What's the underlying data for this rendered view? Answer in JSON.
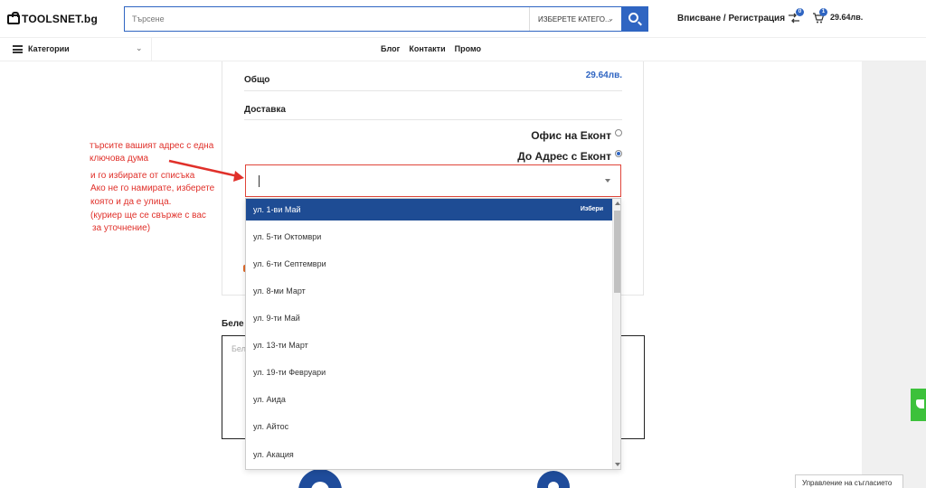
{
  "header": {
    "logo_text": "TOOLSNET.bg",
    "search_placeholder": "Търсене",
    "category_select": "ИЗБЕРЕТЕ КАТЕГО...",
    "login_text": "Вписване / Регистрация",
    "compare_count": "0",
    "cart_count": "1",
    "cart_total": "29.64лв."
  },
  "nav": {
    "categories_label": "Категории",
    "links": [
      "Блог",
      "Контакти",
      "Промо"
    ]
  },
  "order": {
    "total_label": "Общо",
    "total_value": "29.64лв.",
    "delivery_label": "Доставка",
    "options": [
      {
        "label": "Офис на Еконт",
        "selected": false
      },
      {
        "label": "До Адрес с Еконт",
        "selected": true
      }
    ]
  },
  "address_select": {
    "value": "",
    "options": [
      {
        "label": "ул. 1-ви Май",
        "hint": "Избери",
        "highlighted": true
      },
      {
        "label": "ул. 5-ти Октомври"
      },
      {
        "label": "ул. 6-ти Септември"
      },
      {
        "label": "ул. 8-ми Март"
      },
      {
        "label": "ул. 9-ти Май"
      },
      {
        "label": "ул. 13-ти Март"
      },
      {
        "label": "ул. 19-ти Февруари"
      },
      {
        "label": "ул. Аида"
      },
      {
        "label": "ул. Айтос"
      },
      {
        "label": "ул. Акация"
      }
    ]
  },
  "notes": {
    "label": "Беле",
    "placeholder": "Беле"
  },
  "annotation": {
    "line1": "търсите вашият адрес с една",
    "line2": "ключова дума",
    "line3": "и го избирате от списъка",
    "line4": "Ако не го намирате, изберете",
    "line5": "която и да е улица.",
    "line6": "(куриер ще се свърже с вас",
    "line7": "за уточнение)"
  },
  "consent_label": "Управление на съгласието",
  "colors": {
    "brand_blue": "#2f65c2",
    "dropdown_highlight": "#1e4c94",
    "annotation_red": "#e0302a",
    "chat_green": "#3cc13b"
  }
}
